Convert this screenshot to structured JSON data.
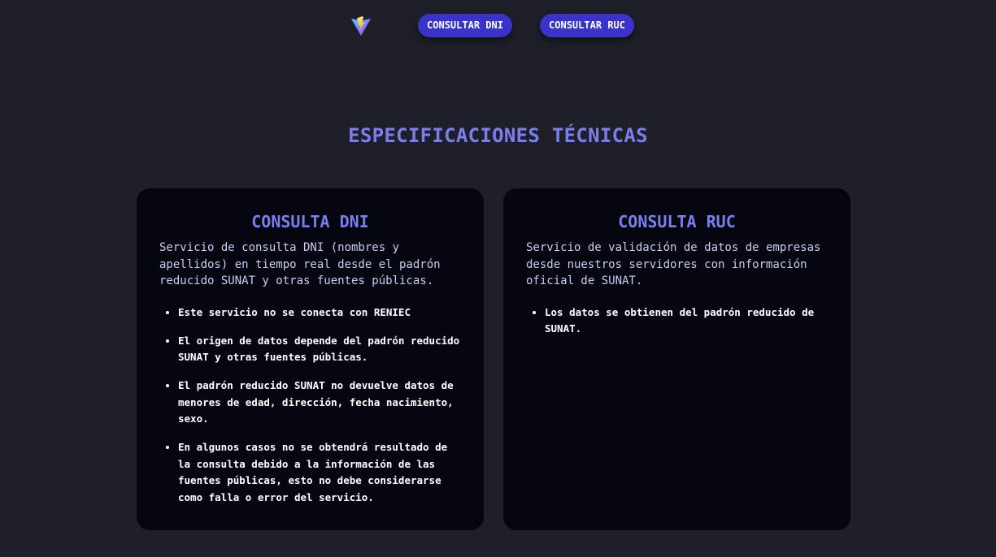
{
  "header": {
    "logo_icon": "vite-logo-icon",
    "nav": [
      {
        "label": "CONSULTAR DNI"
      },
      {
        "label": "CONSULTAR RUC"
      }
    ],
    "button_color": "#3b33c9"
  },
  "main": {
    "title": "ESPECIFICACIONES TÉCNICAS",
    "title_color": "#7a7ff0",
    "cards": [
      {
        "title": "CONSULTA DNI",
        "description": "Servicio de consulta DNI (nombres y apellidos) en tiempo real desde el padrón reducido SUNAT y otras fuentes públicas.",
        "items": [
          "Este servicio no se conecta con RENIEC",
          "El origen de datos depende del padrón reducido SUNAT y otras fuentes públicas.",
          "El padrón reducido SUNAT no devuelve datos de menores de edad, dirección, fecha nacimiento, sexo.",
          "En algunos casos no se obtendrá resultado de la consulta debido a la información de las fuentes públicas, esto no debe considerarse como falla o error del servicio."
        ]
      },
      {
        "title": "CONSULTA RUC",
        "description": "Servicio de validación de datos de empresas desde nuestros servidores con información oficial de SUNAT.",
        "items": [
          "Los datos se obtienen del padrón reducido de SUNAT."
        ]
      }
    ]
  }
}
